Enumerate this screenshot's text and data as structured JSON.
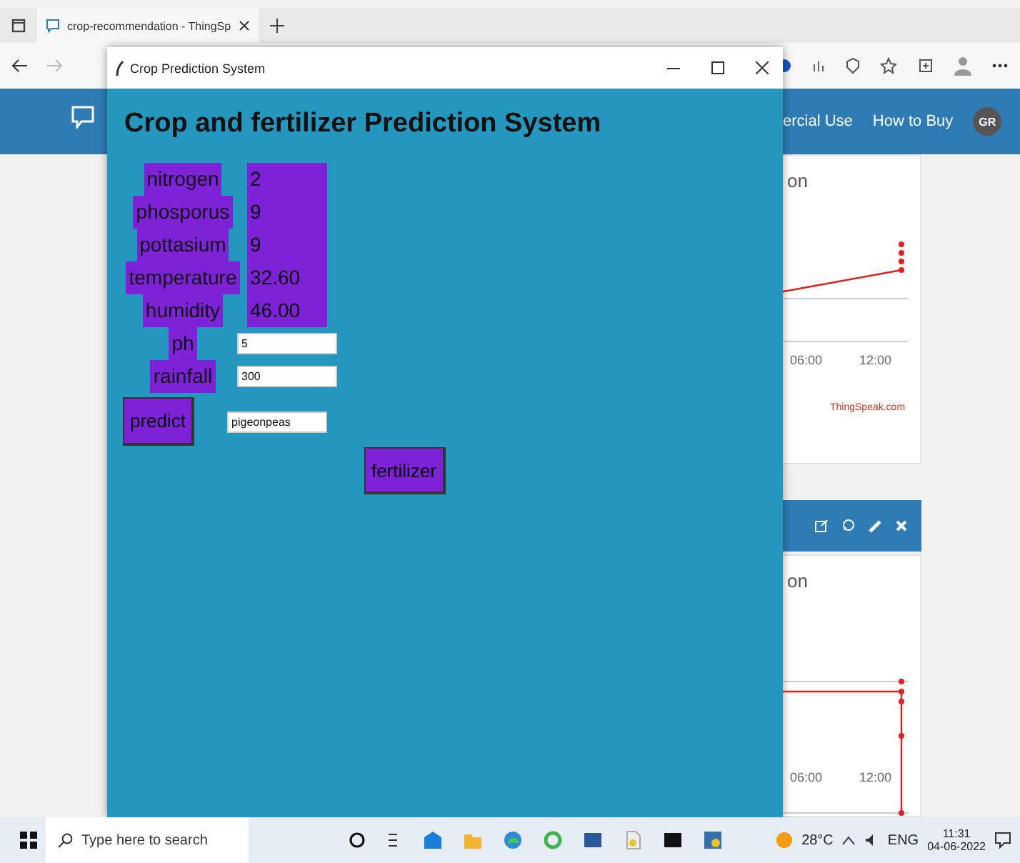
{
  "browser": {
    "tab_title": "crop-recommendation - ThingSp"
  },
  "site_nav": {
    "links": [
      "ercial Use",
      "How to Buy"
    ],
    "avatar": "GR"
  },
  "cards": [
    {
      "title": "on",
      "x_ticks": [
        "06:00",
        "12:00"
      ],
      "credit": "ThingSpeak.com"
    },
    {
      "title": "on",
      "x_ticks": [
        "06:00",
        "12:00"
      ]
    }
  ],
  "app_window": {
    "title": "Crop Prediction System",
    "heading": "Crop and fertilizer Prediction System",
    "inputs": [
      {
        "label": "nitrogen",
        "value": "2",
        "kind": "display"
      },
      {
        "label": "phosporus",
        "value": "9",
        "kind": "display"
      },
      {
        "label": "pottasium",
        "value": "9",
        "kind": "display"
      },
      {
        "label": "temperature",
        "value": "32.60",
        "kind": "display"
      },
      {
        "label": "humidity",
        "value": "46.00",
        "kind": "display"
      },
      {
        "label": "ph",
        "value": "5",
        "kind": "entry"
      },
      {
        "label": "rainfall",
        "value": "300",
        "kind": "entry"
      }
    ],
    "predict_button": "predict",
    "result": "pigeonpeas",
    "fertilizer_button": "fertilizer"
  },
  "taskbar": {
    "search_placeholder": "Type here to search",
    "weather": "28°C",
    "language": "ENG",
    "time": "11:31",
    "date": "04-06-2022"
  }
}
